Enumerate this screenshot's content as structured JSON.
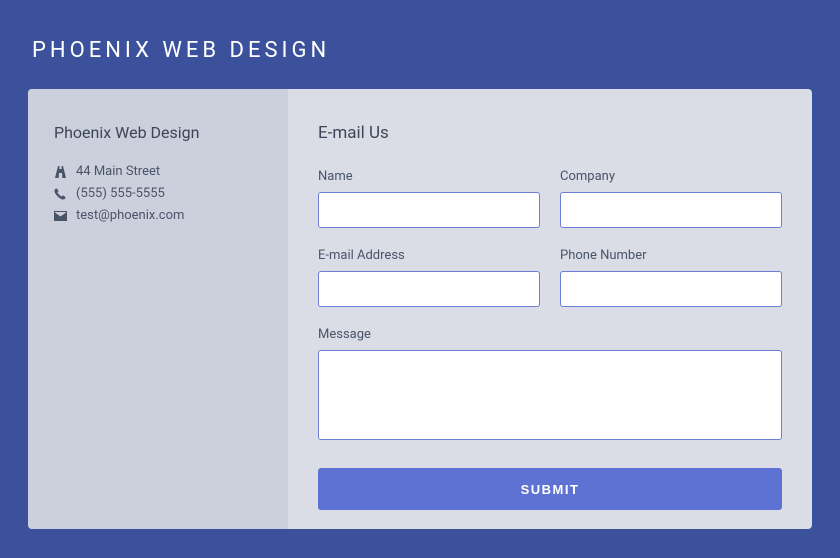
{
  "header": {
    "title": "PHOENIX WEB DESIGN"
  },
  "sidebar": {
    "company": "Phoenix Web Design",
    "address": "44 Main Street",
    "phone": "(555) 555-5555",
    "email": "test@phoenix.com"
  },
  "form": {
    "heading": "E-mail Us",
    "name_label": "Name",
    "company_label": "Company",
    "email_label": "E-mail Address",
    "phone_label": "Phone Number",
    "message_label": "Message",
    "name_value": "",
    "company_value": "",
    "email_value": "",
    "phone_value": "",
    "message_value": "",
    "submit_label": "SUBMIT"
  },
  "colors": {
    "page_bg": "#3c519c",
    "card_bg": "#dadde6",
    "sidebar_bg": "#ccd0dd",
    "accent": "#5e72d3",
    "border": "#6c7fd6"
  }
}
